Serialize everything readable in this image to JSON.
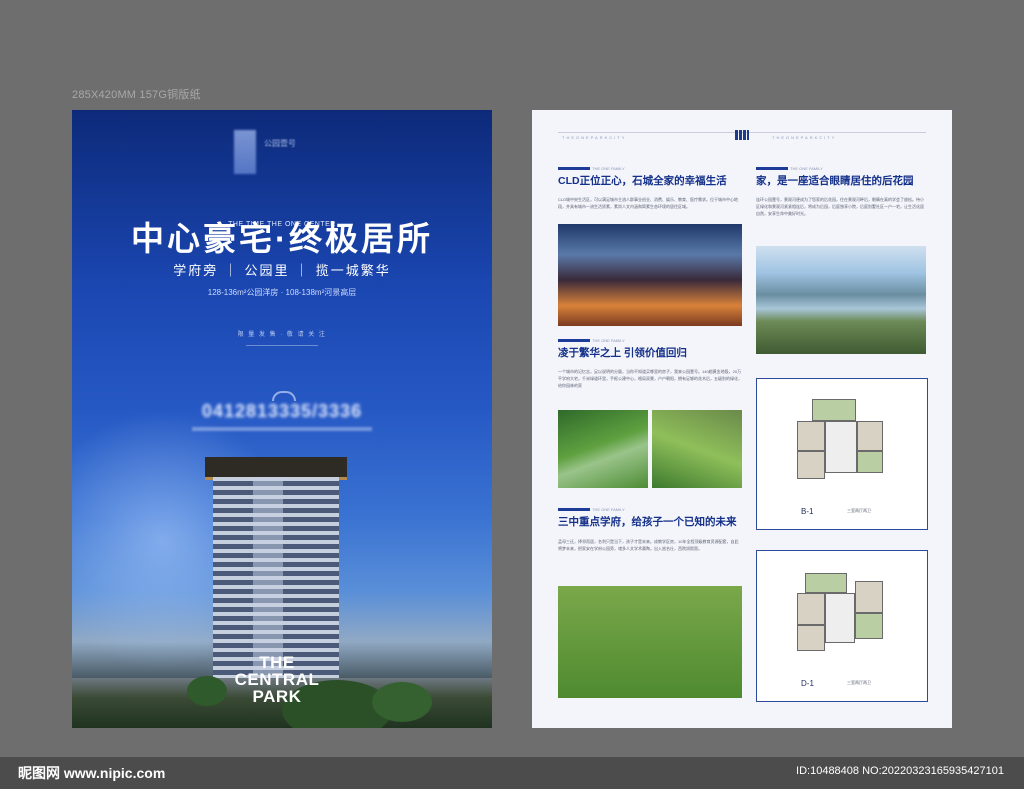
{
  "spec": "285X420MM 157G铜版纸",
  "front": {
    "logo_text": "公园壹号",
    "en_tagline": "THE TIME THE ONE CENTER",
    "title": "中心豪宅·终极居所",
    "subtitle": "学府旁 ｜ 公园里 ｜ 揽一城繁华",
    "spec_line": "128-136m²公园洋房 · 108-138m²河景高层",
    "limit_text": "限 量 发 售 · 敬 请 关 注",
    "phone": "0412813335/3336",
    "tag_line1": "THE",
    "tag_line2": "CENTRAL",
    "tag_line3": "PARK"
  },
  "back": {
    "header_left": "THEONEPARKCITY",
    "header_right": "THEONEPARKCITY",
    "section1": {
      "en": "THE ONE FAMILY",
      "heading": "CLD正位正心，石城全家的幸福生活",
      "text": "CLD城中央生活区，可以满足城市主流人群事业创业、消费、娱乐、教育、医疗需求。位于城市中心地段，并具有城市一流生活质素，素尚人文内涵和简素生态环境的居住区域。"
    },
    "section2": {
      "en": "THE ONE FAMILY",
      "heading": "凌于繁华之上 引领价值回归",
      "text": "一个城市的记忆志，足以说明的分量，当你不知道买哪里的房子，我来公园壹号。140趟黄金地段，20万平学府大宅，千米绿道环里，手框公建中心，格局双景，户户朝阳，拥有足够的花木后，五级别的绿化，给你园林的家"
    },
    "section3": {
      "en": "THE ONE FAMILY",
      "heading": "三中重点学府，给孩子一个已知的未来",
      "text": "孟母三迁，择邻而居，名利只是当下，孩子才是未来。成教学区房，10年全程顶级教育资源配套，自此将梦未来，把家安在学府公园旁，诸多人文学术熏陶，出入皆名仕，西院润熙恩。"
    },
    "section4": {
      "en": "THE ONE FAMILY",
      "heading": "家，是一座适合眼睛居住的后花园",
      "text": "连环公园壹号，景观河便成为了您家的后花园，住在景观河畔后，眼睛在真的学会了放松。待小区绿化和景观河紧紧相连后，将成为后园，后庭独享小院，后庭别墅社区一户一宅，让生活化居自然，安享生命中美好时光。"
    },
    "plan1": {
      "code": "B-1",
      "label": "三室两厅两卫"
    },
    "plan2": {
      "code": "D-1",
      "label": "三室两厅两卫"
    }
  },
  "footer": {
    "site": "昵图网 www.nipic.com",
    "id": "ID:10488408 NO:20220323165935427101"
  }
}
